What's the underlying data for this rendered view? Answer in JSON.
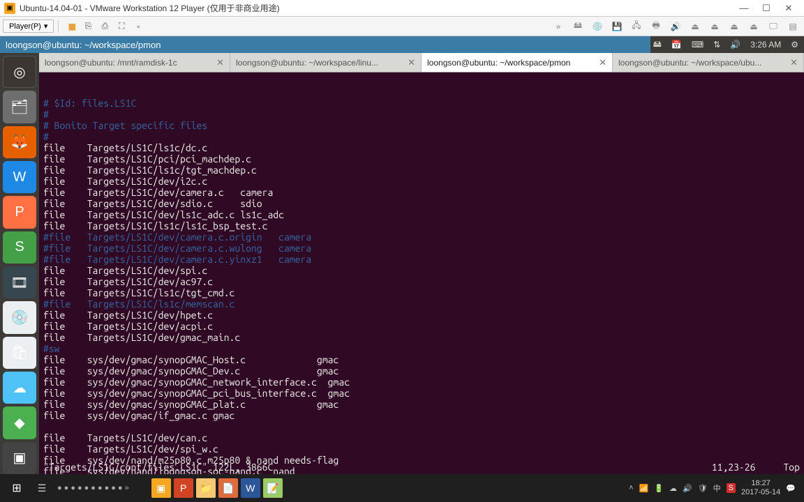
{
  "vmware": {
    "title": "Ubuntu-14.04-01 - VMware Workstation 12 Player (仅用于非商业用途)",
    "player_label": "Player(P)"
  },
  "ubuntu_menubar": {
    "title": "loongson@ubuntu: ~/workspace/pmon",
    "time": "3:26 AM"
  },
  "tabs": [
    {
      "label": "loongson@ubuntu: /mnt/ramdisk-1c",
      "active": false
    },
    {
      "label": "loongson@ubuntu: ~/workspace/linu...",
      "active": false
    },
    {
      "label": "loongson@ubuntu: ~/workspace/pmon",
      "active": true
    },
    {
      "label": "loongson@ubuntu: ~/workspace/ubu...",
      "active": false
    }
  ],
  "terminal": {
    "lines": [
      {
        "cls": "c-comment",
        "text": "# $Id: files.LS1C"
      },
      {
        "cls": "c-comment",
        "text": "#"
      },
      {
        "cls": "c-comment",
        "text": "# Bonito Target specific files"
      },
      {
        "cls": "c-comment",
        "text": "#"
      },
      {
        "cls": "c-text",
        "text": "file    Targets/LS1C/ls1c/dc.c"
      },
      {
        "cls": "c-text",
        "text": "file    Targets/LS1C/pci/pci_machdep.c"
      },
      {
        "cls": "c-text",
        "text": "file    Targets/LS1C/ls1c/tgt_machdep.c"
      },
      {
        "cls": "c-text",
        "text": "file    Targets/LS1C/dev/i2c.c"
      },
      {
        "cls": "c-text",
        "text": "file    Targets/LS1C/dev/camera.c   camera"
      },
      {
        "cls": "c-text",
        "text": "file    Targets/LS1C/dev/sdio.c     sdio"
      },
      {
        "cls": "c-text",
        "text": "file    Targets/LS1C/dev/ls1c_adc.c ls1c_adc"
      },
      {
        "cls": "c-text",
        "text": "file    Targets/LS1C/ls1c/ls1c_bsp_test.c"
      },
      {
        "cls": "c-comment",
        "text": "#file   Targets/LS1C/dev/camera.c.origin   camera"
      },
      {
        "cls": "c-comment",
        "text": "#file   Targets/LS1C/dev/camera.c.wulong   camera"
      },
      {
        "cls": "c-comment",
        "text": "#file   Targets/LS1C/dev/camera.c.yinxz1   camera"
      },
      {
        "cls": "c-text",
        "text": "file    Targets/LS1C/dev/spi.c"
      },
      {
        "cls": "c-text",
        "text": "file    Targets/LS1C/dev/ac97.c"
      },
      {
        "cls": "c-text",
        "text": "file    Targets/LS1C/ls1c/tgt_cmd.c"
      },
      {
        "cls": "c-comment",
        "text": "#file   Targets/LS1C/ls1c/memscan.c"
      },
      {
        "cls": "c-text",
        "text": "file    Targets/LS1C/dev/hpet.c"
      },
      {
        "cls": "c-text",
        "text": "file    Targets/LS1C/dev/acpi.c"
      },
      {
        "cls": "c-text",
        "text": "file    Targets/LS1C/dev/gmac_main.c"
      },
      {
        "cls": "c-comment",
        "text": "#sw"
      },
      {
        "cls": "c-text",
        "text": "file    sys/dev/gmac/synopGMAC_Host.c             gmac"
      },
      {
        "cls": "c-text",
        "text": "file    sys/dev/gmac/synopGMAC_Dev.c              gmac"
      },
      {
        "cls": "c-text",
        "text": "file    sys/dev/gmac/synopGMAC_network_interface.c  gmac"
      },
      {
        "cls": "c-text",
        "text": "file    sys/dev/gmac/synopGMAC_pci_bus_interface.c  gmac"
      },
      {
        "cls": "c-text",
        "text": "file    sys/dev/gmac/synopGMAC_plat.c             gmac"
      },
      {
        "cls": "c-text",
        "text": "file    sys/dev/gmac/if_gmac.c gmac"
      },
      {
        "cls": "c-text",
        "text": ""
      },
      {
        "cls": "c-text",
        "text": "file    Targets/LS1C/dev/can.c"
      },
      {
        "cls": "c-text",
        "text": "file    Targets/LS1C/dev/spi_w.c"
      },
      {
        "cls": "c-text",
        "text": "file    sys/dev/nand/m25p80.c m25p80 & nand needs-flag"
      },
      {
        "cls": "c-text",
        "text": "file    sys/dev/nand/loongson-soc-nand.c  nand"
      }
    ],
    "status_left": "\"Targets/LS1C/conf/files.LS1C\" 122L, 3866C",
    "status_mid": "11,23-26",
    "status_right": "Top"
  },
  "win_taskbar": {
    "time": "18:27",
    "date": "2017-05-14",
    "ime": "中"
  }
}
